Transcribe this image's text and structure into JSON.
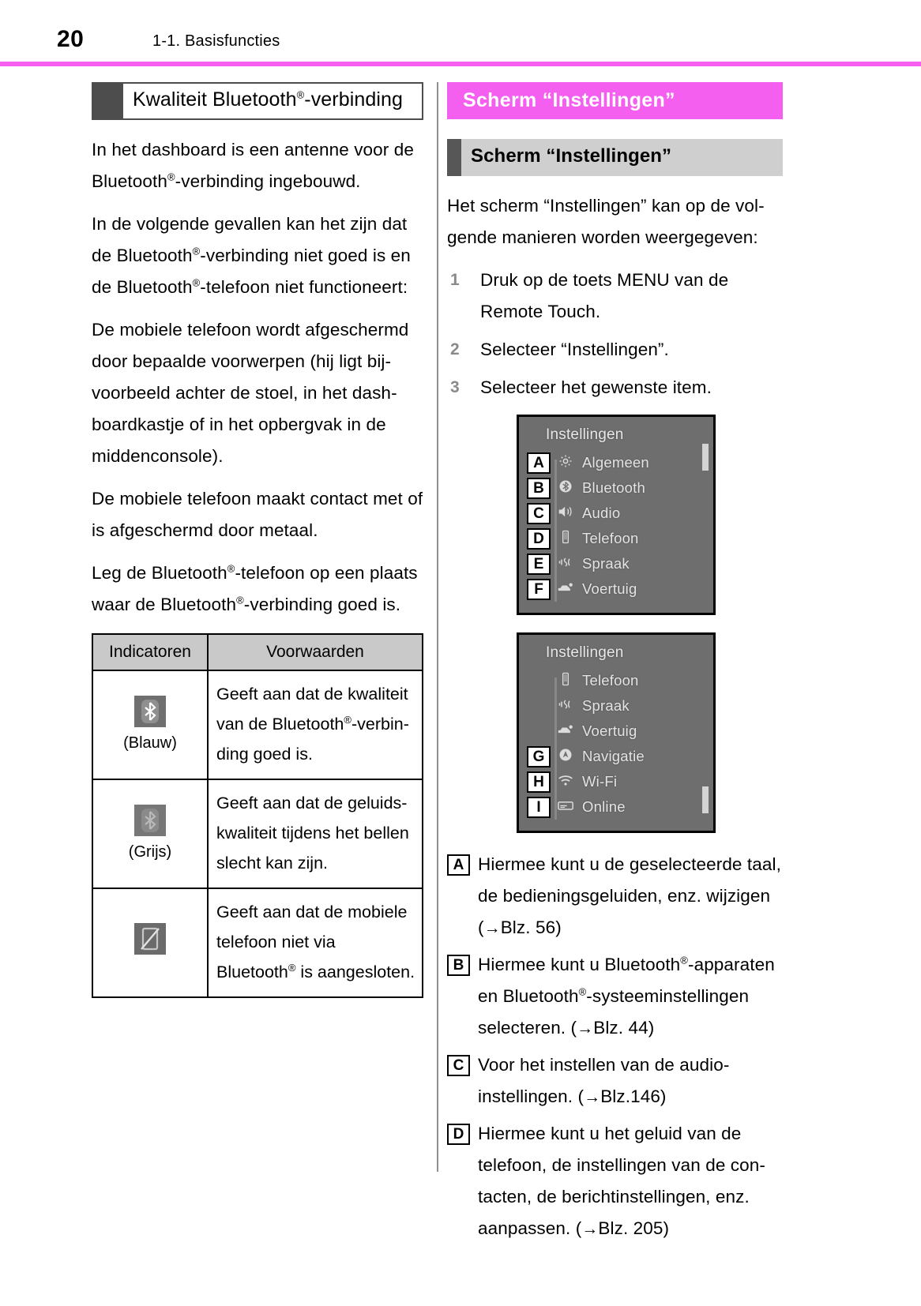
{
  "header": {
    "page_number": "20",
    "section_label": "1-1. Basisfuncties",
    "rule_color": "#f45ff0"
  },
  "left_column": {
    "subhead": "Kwaliteit Bluetooth®-verbinding",
    "paragraphs": [
      "In het dashboard is een antenne voor de Bluetooth®-verbinding ingebouwd.",
      "In de volgende gevallen kan het zijn dat de Bluetooth®-verbinding niet goed is en de Bluetooth®-telefoon niet functioneert:",
      "De mobiele telefoon wordt afgeschermd door bepaalde voorwerpen (hij ligt bijvoorbeeld achter de stoel, in het dashboardkastje of in het opbergvak in de middenconsole).",
      "De mobiele telefoon maakt contact met of is afgeschermd door metaal.",
      "Leg de Bluetooth®-telefoon op een plaats waar de Bluetooth®-verbinding goed is."
    ],
    "table": {
      "headers": [
        "Indicatoren",
        "Voorwaarden"
      ],
      "rows": [
        {
          "icon_name": "bluetooth-icon-blue",
          "icon_caption": "(Blauw)",
          "condition": "Geeft aan dat de kwaliteit van de Bluetooth®-verbinding goed is."
        },
        {
          "icon_name": "bluetooth-icon-grey",
          "icon_caption": "(Grijs)",
          "condition": "Geeft aan dat de geluidskwaliteit tijdens het bellen slecht kan zijn."
        },
        {
          "icon_name": "phone-disconnected-icon",
          "icon_caption": "",
          "condition": "Geeft aan dat de mobiele telefoon niet via Bluetooth® is aangesloten."
        }
      ]
    }
  },
  "right_column": {
    "banner": "Scherm “Instellingen”",
    "subbanner": "Scherm “Instellingen”",
    "intro": "Het scherm “Instellingen” kan op de volgende manieren worden weergegeven:",
    "steps": [
      {
        "num": "1",
        "text": "Druk op de toets MENU van de Remote Touch."
      },
      {
        "num": "2",
        "text": "Selecteer “Instellingen”."
      },
      {
        "num": "3",
        "text": "Selecteer het gewenste item."
      }
    ],
    "screenshot_1": {
      "title": "Instellingen",
      "rows": [
        {
          "badge": "A",
          "icon": "gear-icon",
          "label": "Algemeen"
        },
        {
          "badge": "B",
          "icon": "bluetooth-icon",
          "label": "Bluetooth"
        },
        {
          "badge": "C",
          "icon": "speaker-icon",
          "label": "Audio"
        },
        {
          "badge": "D",
          "icon": "phone-icon",
          "label": "Telefoon"
        },
        {
          "badge": "E",
          "icon": "voice-icon",
          "label": "Spraak"
        },
        {
          "badge": "F",
          "icon": "vehicle-icon",
          "label": "Voertuig"
        }
      ]
    },
    "screenshot_2": {
      "title": "Instellingen",
      "rows": [
        {
          "badge": "",
          "icon": "phone-icon",
          "label": "Telefoon"
        },
        {
          "badge": "",
          "icon": "voice-icon",
          "label": "Spraak"
        },
        {
          "badge": "",
          "icon": "vehicle-icon",
          "label": "Voertuig"
        },
        {
          "badge": "G",
          "icon": "navigation-icon",
          "label": "Navigatie"
        },
        {
          "badge": "H",
          "icon": "wifi-icon",
          "label": "Wi-Fi"
        },
        {
          "badge": "I",
          "icon": "online-icon",
          "label": "Online"
        }
      ]
    },
    "legend": [
      {
        "badge": "A",
        "text": "Hiermee kunt u de geselecteerde taal, de bedieningsgeluiden, enz. wijzigen (→Blz. 56)"
      },
      {
        "badge": "B",
        "text": "Hiermee kunt u Bluetooth®-apparaten en Bluetooth®-systeeminstellingen selecteren. (→Blz. 44)"
      },
      {
        "badge": "C",
        "text": "Voor het instellen van de audio-instellingen. (→Blz.146)"
      },
      {
        "badge": "D",
        "text": "Hiermee kunt u het geluid van de telefoon, de instellingen van de contacten, de berichtinstellingen, enz. aanpassen. (→Blz. 205)"
      }
    ]
  }
}
